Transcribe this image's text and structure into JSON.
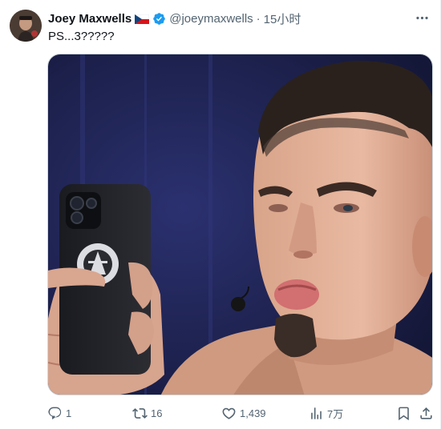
{
  "post": {
    "author_name": "Joey Maxwells",
    "author_flag": "czech-flag",
    "author_verified": true,
    "handle": "@joeymaxwells",
    "separator": "·",
    "timestamp": "15小时",
    "text": "PS...3?????",
    "media": {
      "description_icon": "photo-man-looking-at-phone"
    }
  },
  "actions": {
    "reply_count": "1",
    "repost_count": "16",
    "like_count": "1,439",
    "view_count": "7万"
  },
  "colors": {
    "text_primary": "#0f1419",
    "text_secondary": "#536471",
    "verified_blue": "#1d9bf0",
    "stage_background": "#1f2456"
  }
}
